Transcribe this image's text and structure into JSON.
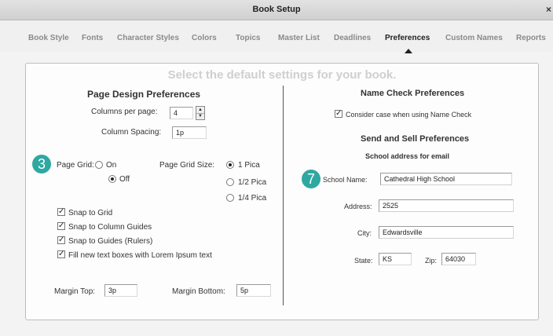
{
  "window": {
    "title": "Book Setup",
    "close_glyph": "×"
  },
  "tabs": [
    {
      "label": "Book Style"
    },
    {
      "label": "Fonts"
    },
    {
      "label": "Character Styles"
    },
    {
      "label": "Colors"
    },
    {
      "label": "Topics"
    },
    {
      "label": "Master List"
    },
    {
      "label": "Deadlines"
    },
    {
      "label": "Preferences",
      "active": true
    },
    {
      "label": "Custom Names"
    },
    {
      "label": "Reports"
    }
  ],
  "banner": "Select the default settings for your book.",
  "page_design": {
    "heading": "Page Design Preferences",
    "columns_label": "Columns per page:",
    "columns_value": "4",
    "column_spacing_label": "Column Spacing:",
    "column_spacing_value": "1p",
    "page_grid_label": "Page Grid:",
    "page_grid_options": [
      "On",
      "Off"
    ],
    "page_grid_selected": "Off",
    "grid_size_label": "Page Grid Size:",
    "grid_size_options": [
      "1 Pica",
      "1/2 Pica",
      "1/4 Pica"
    ],
    "grid_size_selected": "1 Pica",
    "checkboxes": [
      {
        "label": "Snap to Grid",
        "checked": true
      },
      {
        "label": "Snap to Column Guides",
        "checked": true
      },
      {
        "label": "Snap to Guides (Rulers)",
        "checked": true
      },
      {
        "label": "Fill new text boxes with Lorem Ipsum text",
        "checked": true
      }
    ],
    "margin_top_label": "Margin Top:",
    "margin_top_value": "3p",
    "margin_bottom_label": "Margin Bottom:",
    "margin_bottom_value": "5p"
  },
  "name_check": {
    "heading": "Name Check Preferences",
    "checkbox_label": "Consider case when using Name Check",
    "checkbox_checked": true
  },
  "send_sell": {
    "heading": "Send and Sell Preferences",
    "subheading": "School address for email",
    "school_name_label": "School Name:",
    "school_name_value": "Cathedral High School",
    "address_label": "Address:",
    "address_value": "2525",
    "city_label": "City:",
    "city_value": "Edwardsville",
    "state_label": "State:",
    "state_value": "KS",
    "zip_label": "Zip:",
    "zip_value": "64030"
  },
  "callouts": {
    "left": "3",
    "right": "7",
    "color": "#2ea8a0"
  },
  "check_glyph": "✓",
  "stepper_up": "▲",
  "stepper_down": "▼"
}
